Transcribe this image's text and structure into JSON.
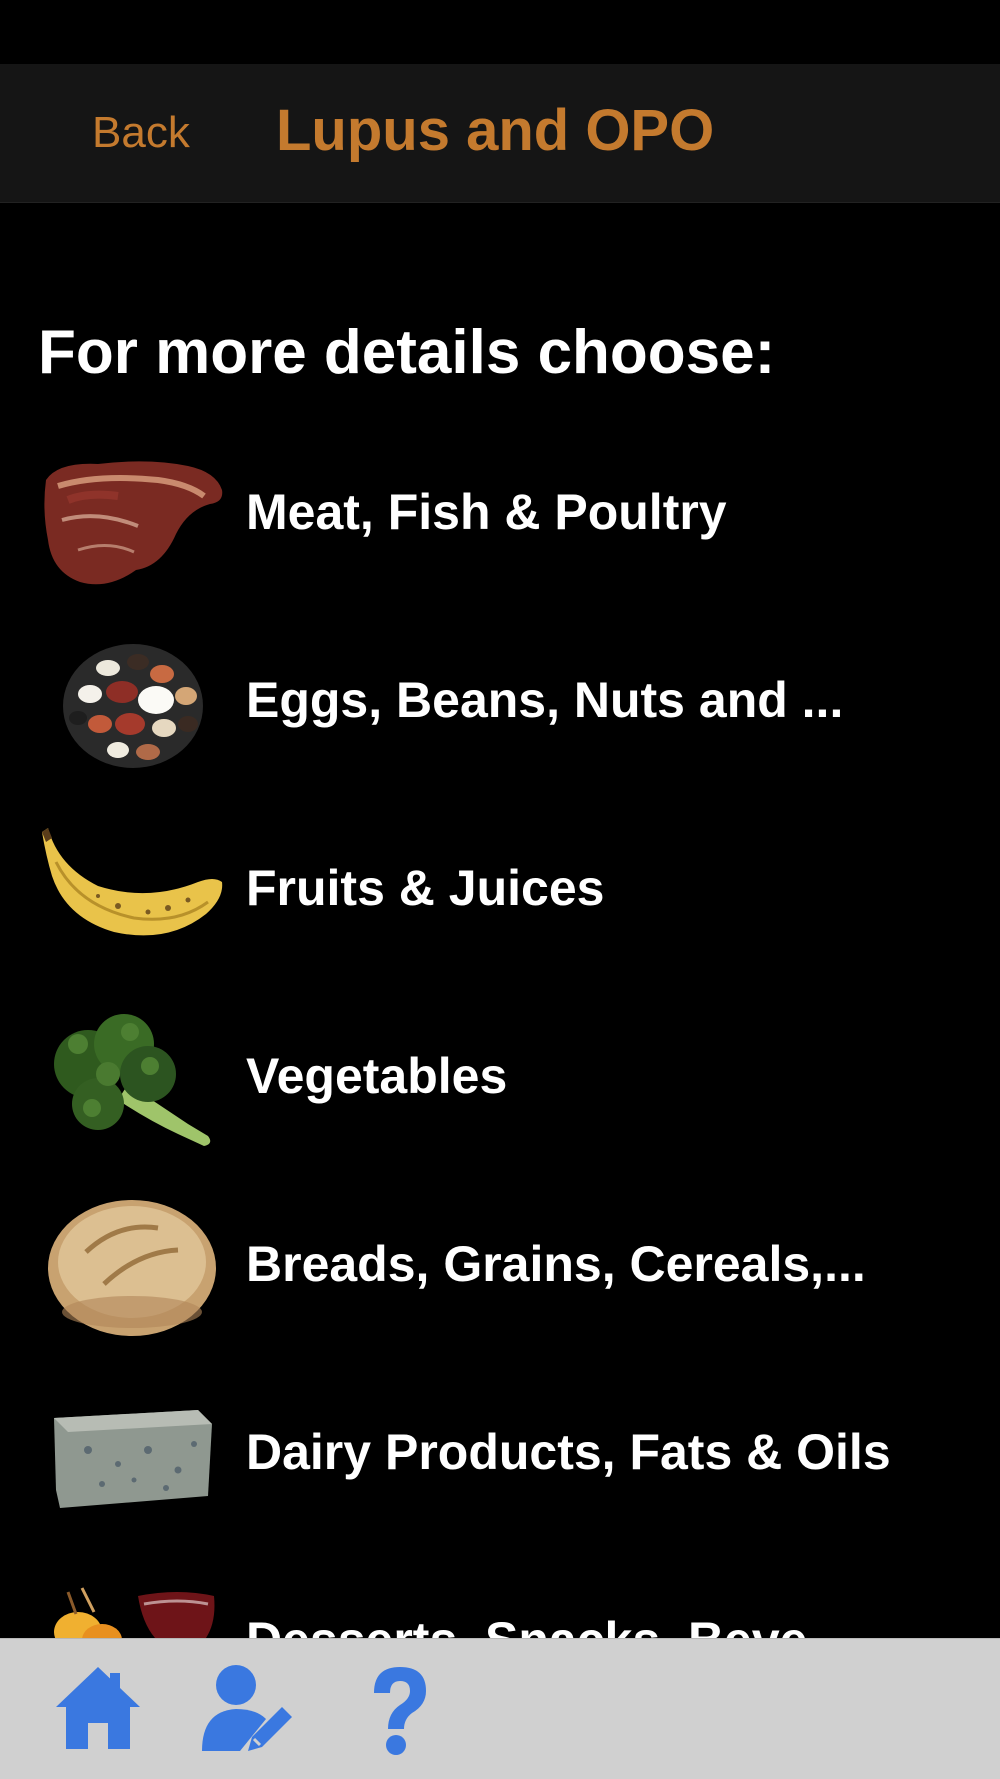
{
  "nav": {
    "back_label": "Back",
    "title": "Lupus and OPO"
  },
  "heading": "For more details choose:",
  "categories": [
    {
      "label": "Meat, Fish & Poultry",
      "icon": "steak-icon"
    },
    {
      "label": "Eggs, Beans, Nuts and ...",
      "icon": "beans-icon"
    },
    {
      "label": "Fruits & Juices",
      "icon": "banana-icon"
    },
    {
      "label": "Vegetables",
      "icon": "broccoli-icon"
    },
    {
      "label": "Breads, Grains, Cereals,...",
      "icon": "bread-icon"
    },
    {
      "label": "Dairy Products, Fats & Oils",
      "icon": "cheese-icon"
    },
    {
      "label": "Desserts, Snacks, Beve...",
      "icon": "dessert-wine-icon"
    }
  ],
  "tab_bar": {
    "items": [
      {
        "icon": "home-icon"
      },
      {
        "icon": "edit-user-icon"
      },
      {
        "icon": "help-icon"
      }
    ]
  },
  "colors": {
    "accent": "#c47a2e",
    "tab_icon": "#3a78e0",
    "background": "#000000",
    "nav_bar": "#151515",
    "tab_bar": "#d0d0d0"
  }
}
